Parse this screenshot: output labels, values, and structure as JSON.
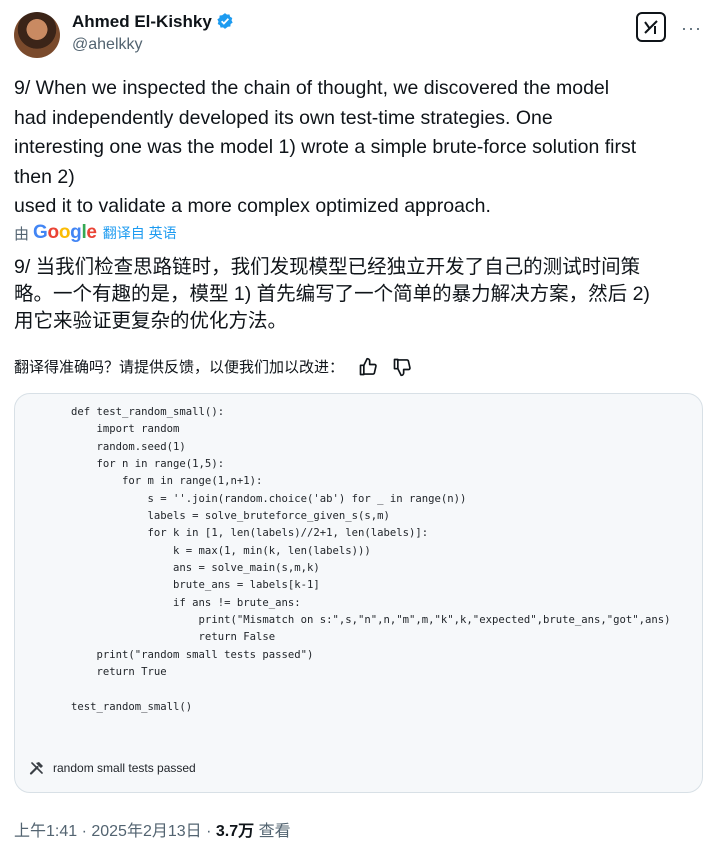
{
  "author": {
    "name": "Ahmed El-Kishky",
    "handle": "@ahelkky"
  },
  "header": {
    "more_label": "···"
  },
  "post": {
    "lines": [
      "9/ When we inspected the chain of thought, we discovered the model",
      "had independently developed its own test-time strategies. One",
      "interesting one was the model 1) wrote a simple brute-force solution first",
      "then 2)",
      "used it to validate a more complex optimized approach."
    ]
  },
  "translation": {
    "by": "由",
    "provider": "Google",
    "link": "翻译自 英语",
    "lines": [
      "9/ 当我们检查思路链时，我们发现模型已经独立开发了自己的测试时间策",
      "略。一个有趣的是，模型 1) 首先编写了一个简单的暴力解决方案，然后 2)",
      "用它来验证更复杂的优化方法。"
    ],
    "feedback": "翻译得准确吗？请提供反馈，以便我们加以改进："
  },
  "code": {
    "text": "def test_random_small():\n    import random\n    random.seed(1)\n    for n in range(1,5):\n        for m in range(1,n+1):\n            s = ''.join(random.choice('ab') for _ in range(n))\n            labels = solve_bruteforce_given_s(s,m)\n            for k in [1, len(labels)//2+1, len(labels)]:\n                k = max(1, min(k, len(labels)))\n                ans = solve_main(s,m,k)\n                brute_ans = labels[k-1]\n                if ans != brute_ans:\n                    print(\"Mismatch on s:\",s,\"n\",n,\"m\",m,\"k\",k,\"expected\",brute_ans,\"got\",ans)\n                    return False\n    print(\"random small tests passed\")\n    return True\n\ntest_random_small()",
    "result": "random small tests passed"
  },
  "meta": {
    "time": "上午1:41 · 2025年2月13日 · ",
    "views": "3.7万",
    "views_label": " 查看"
  },
  "colors": {
    "verified": "#1d9bf0",
    "link": "#1d9bf0",
    "muted": "#536471"
  },
  "icons": [
    "verified-badge-icon",
    "grok-icon",
    "more-icon",
    "thumb-up-icon",
    "thumb-down-icon",
    "hammer-icon"
  ]
}
